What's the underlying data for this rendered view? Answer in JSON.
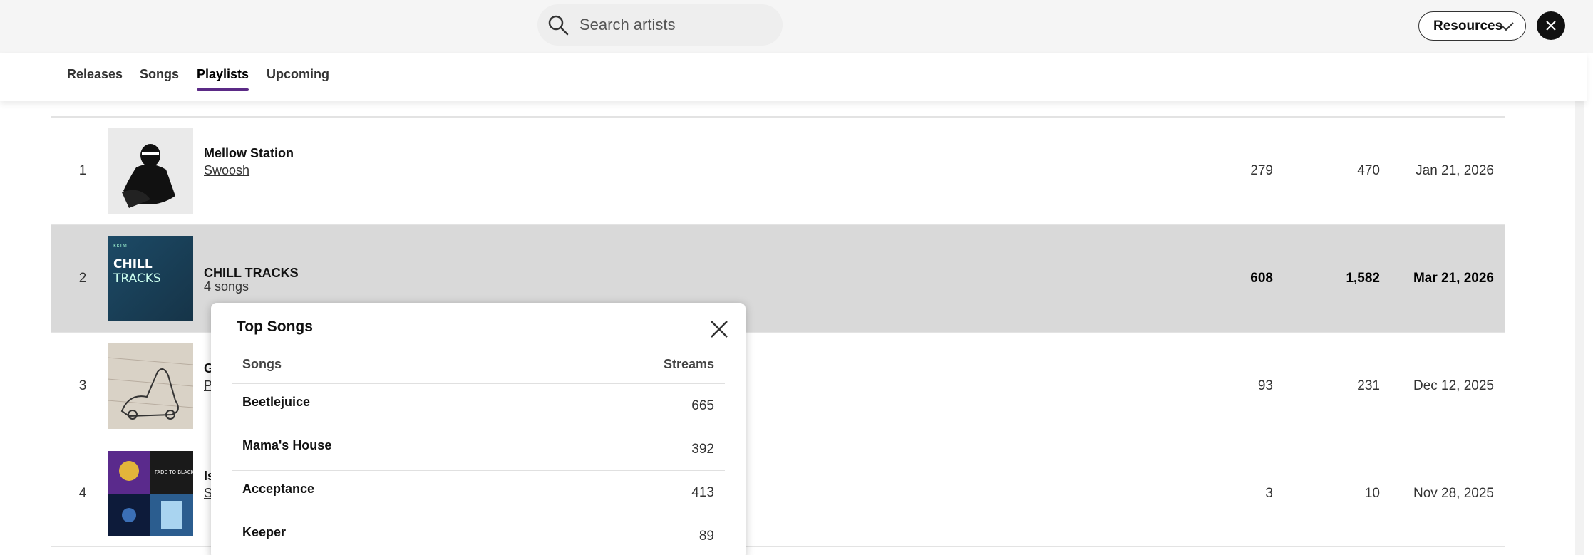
{
  "search": {
    "placeholder": "Search artists",
    "icon": "search-icon"
  },
  "header": {
    "resources_label": "Resources"
  },
  "tabs": [
    {
      "label": "Releases",
      "active": false
    },
    {
      "label": "Songs",
      "active": false
    },
    {
      "label": "Playlists",
      "active": true
    },
    {
      "label": "Upcoming",
      "active": false
    }
  ],
  "playlists": [
    {
      "rank": "1",
      "title": "Mellow Station",
      "subtitle": "Swoosh",
      "col1": "279",
      "col2": "470",
      "date": "Jan 21, 2026"
    },
    {
      "rank": "2",
      "title": "CHILL TRACKS",
      "subtitle": "4 songs",
      "col1": "608",
      "col2": "1,582",
      "date": "Mar 21, 2026",
      "thumb_text": "CHILL TRACKS",
      "thumb_small": "KKTM"
    },
    {
      "rank": "3",
      "title": "G",
      "subtitle": "P",
      "col1": "93",
      "col2": "231",
      "date": "Dec 12, 2025"
    },
    {
      "rank": "4",
      "title": "Is",
      "subtitle": "S",
      "col1": "3",
      "col2": "10",
      "date": "Nov 28, 2025",
      "thumb_text": "FADE TO BLACK"
    }
  ],
  "popup": {
    "title": "Top Songs",
    "col_songs": "Songs",
    "col_streams": "Streams",
    "songs": [
      {
        "name": "Beetlejuice",
        "streams": "665"
      },
      {
        "name": "Mama's House",
        "streams": "392"
      },
      {
        "name": "Acceptance",
        "streams": "413"
      },
      {
        "name": "Keeper",
        "streams": "89"
      }
    ]
  },
  "colors": {
    "accent": "#5b2a86",
    "highlight_row": "#d9d9d9"
  }
}
